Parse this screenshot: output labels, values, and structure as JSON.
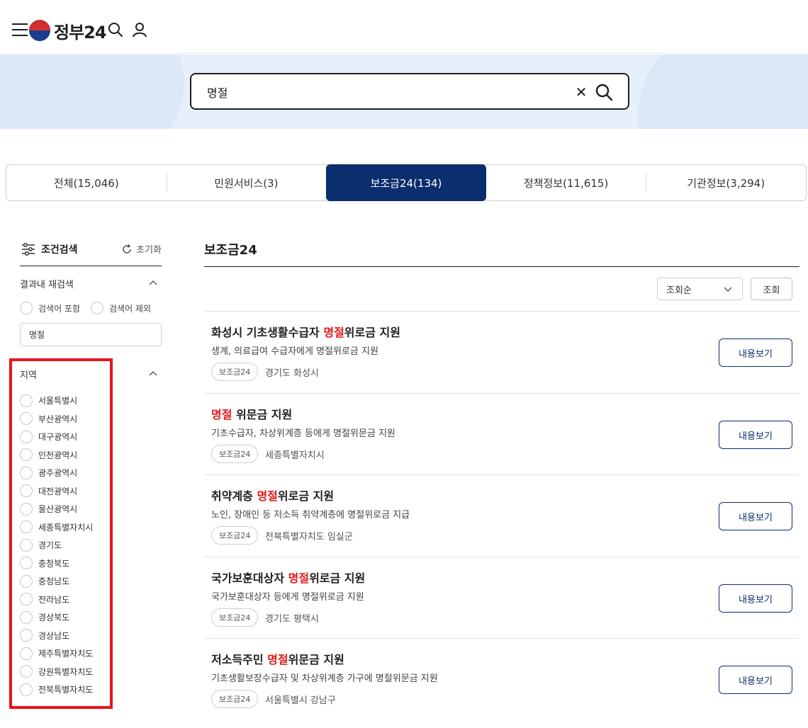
{
  "header": {
    "logo_text": "정부24"
  },
  "search": {
    "value": "명절"
  },
  "tabs": [
    {
      "label": "전체(15,046)",
      "active": false
    },
    {
      "label": "민원서비스(3)",
      "active": false
    },
    {
      "label": "보조금24(134)",
      "active": true
    },
    {
      "label": "정책정보(11,615)",
      "active": false
    },
    {
      "label": "기관정보(3,294)",
      "active": false
    }
  ],
  "sidebar": {
    "title": "조건검색",
    "reset_label": "초기화",
    "refine": {
      "title": "결과내 재검색",
      "include_label": "검색어 포함",
      "exclude_label": "검색어 제외",
      "input_value": "명절"
    },
    "region": {
      "title": "지역",
      "items": [
        "서울특별시",
        "부산광역시",
        "대구광역시",
        "인천광역시",
        "광주광역시",
        "대전광역시",
        "울산광역시",
        "세종특별자치시",
        "경기도",
        "충청북도",
        "충청남도",
        "전라남도",
        "경상북도",
        "경상남도",
        "제주특별자치도",
        "강원특별자치도",
        "전북특별자치도"
      ]
    }
  },
  "main": {
    "title": "보조금24",
    "sort_value": "조회순",
    "sort_button": "조회",
    "results": [
      {
        "title_pre": "화성시 기초생활수급자 ",
        "title_hl": "명절",
        "title_post": "위로금 지원",
        "desc": "생계, 의료급여 수급자에게 명절위로금 지원",
        "badge": "보조금24",
        "region": "경기도 화성시",
        "button": "내용보기"
      },
      {
        "title_pre": "",
        "title_hl": "명절",
        "title_post": " 위문금 지원",
        "desc": "기초수급자, 차상위계층 등에게 명절위문금 지원",
        "badge": "보조금24",
        "region": "세종특별자치시",
        "button": "내용보기"
      },
      {
        "title_pre": "취약계층 ",
        "title_hl": "명절",
        "title_post": "위로금 지원",
        "desc": "노인, 장애인 등 저소득 취약계층에 명절위로금 지급",
        "badge": "보조금24",
        "region": "전북특별자치도 임실군",
        "button": "내용보기"
      },
      {
        "title_pre": "국가보훈대상자 ",
        "title_hl": "명절",
        "title_post": "위로금 지원",
        "desc": "국가보훈대상자 등에게 명절위로금 지원",
        "badge": "보조금24",
        "region": "경기도 평택시",
        "button": "내용보기"
      },
      {
        "title_pre": "저소득주민 ",
        "title_hl": "명절",
        "title_post": "위문금 지원",
        "desc": "기초생활보장수급자 및 차상위계층 가구에 명절위문금 지원",
        "badge": "보조금24",
        "region": "서울특별시 강남구",
        "button": "내용보기"
      }
    ]
  },
  "colors": {
    "accent": "#0b2e6f",
    "highlight": "#e31a1a",
    "annotation_box": "#e8141b"
  }
}
